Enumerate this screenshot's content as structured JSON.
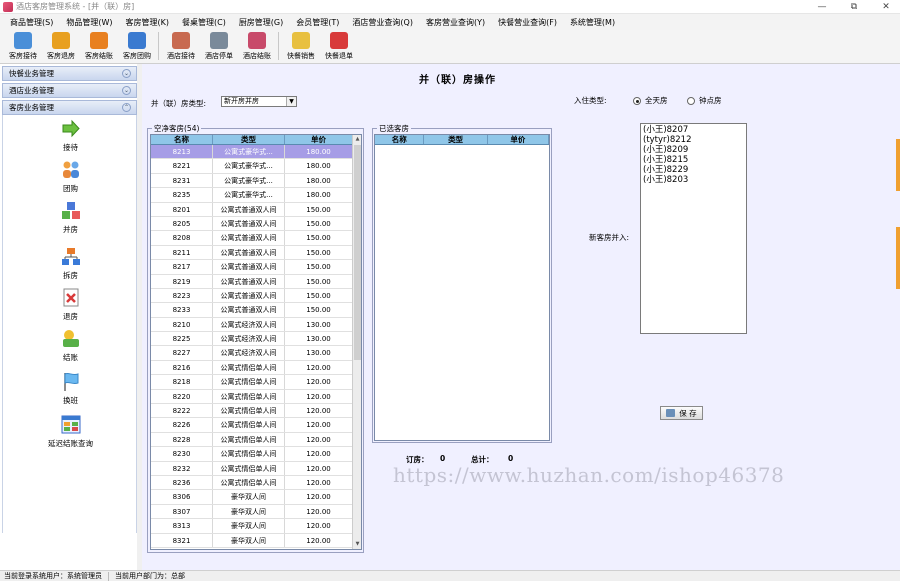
{
  "window": {
    "title": "酒店客房管理系统 - [并（联）房]",
    "controls": [
      "—",
      "⧉",
      "✕"
    ]
  },
  "menu": [
    "商品管理(S)",
    "物品管理(W)",
    "客房管理(K)",
    "餐桌管理(C)",
    "厨房管理(G)",
    "会员管理(T)",
    "酒店营业查询(Q)",
    "客房营业查询(Y)",
    "快餐营业查询(F)",
    "系统管理(M)"
  ],
  "toolbar": [
    {
      "label": "客房接待",
      "icon": "bed-pen-icon",
      "color": "#4a8fd8"
    },
    {
      "label": "客房退房",
      "icon": "checkout-icon",
      "color": "#e8a020"
    },
    {
      "label": "客房结账",
      "icon": "checkout-pay-icon",
      "color": "#e88020"
    },
    {
      "label": "客房团购",
      "icon": "group-buy-icon",
      "color": "#3a7ad0"
    },
    {
      "label": "酒店接待",
      "icon": "reception-card-icon",
      "color": "#c86a50"
    },
    {
      "label": "酒店停单",
      "icon": "tools-icon",
      "color": "#7a8a9a"
    },
    {
      "label": "酒店结账",
      "icon": "people-pay-icon",
      "color": "#c84a6a"
    },
    {
      "label": "快餐销售",
      "icon": "star-sale-icon",
      "color": "#e8c040"
    },
    {
      "label": "快餐退单",
      "icon": "refund-gear-icon",
      "color": "#d83a3a"
    }
  ],
  "sidebar": {
    "sections": [
      "快餐业务管理",
      "酒店业务管理",
      "客房业务管理"
    ],
    "items": [
      {
        "label": "接待",
        "icon": "arrow-right-icon",
        "color": "#4aa82a"
      },
      {
        "label": "团购",
        "icon": "group-people-icon",
        "color": "#e88a2a"
      },
      {
        "label": "并房",
        "icon": "merge-rooms-icon",
        "color": "#3a6ac8"
      },
      {
        "label": "拆房",
        "icon": "split-rooms-icon",
        "color": "#2a7ad8"
      },
      {
        "label": "退房",
        "icon": "checkout-x-icon",
        "color": "#d83a3a"
      },
      {
        "label": "结账",
        "icon": "settle-icon",
        "color": "#e8b020"
      },
      {
        "label": "换班",
        "icon": "flag-icon",
        "color": "#4aa0e0"
      },
      {
        "label": "延迟结账查询",
        "icon": "query-grid-icon",
        "color": "#3a7ad0"
      }
    ]
  },
  "page": {
    "title": "并（联）房操作",
    "type_label": "并（联）房类型:",
    "type_value": "新开房并房",
    "checkin_label": "入住类型:",
    "radio_full_day": "全天房",
    "radio_hourly": "钟点房",
    "empty_group": "空净客房(54)",
    "selected_group": "已选客房",
    "columns": {
      "name": "名称",
      "type": "类型",
      "price": "单价"
    },
    "booking_label": "订房：",
    "booking_value": "0",
    "total_label": "总计：",
    "total_value": "0",
    "merge_label": "新客房并入:",
    "save_button": "保 存",
    "watermark": "https://www.huzhan.com/ishop46378"
  },
  "rooms": [
    {
      "name": "8213",
      "type": "公寓式豪华式...",
      "price": "180.00"
    },
    {
      "name": "8221",
      "type": "公寓式豪华式...",
      "price": "180.00"
    },
    {
      "name": "8231",
      "type": "公寓式豪华式...",
      "price": "180.00"
    },
    {
      "name": "8235",
      "type": "公寓式豪华式...",
      "price": "180.00"
    },
    {
      "name": "8201",
      "type": "公寓式普通双人间",
      "price": "150.00"
    },
    {
      "name": "8205",
      "type": "公寓式普通双人间",
      "price": "150.00"
    },
    {
      "name": "8208",
      "type": "公寓式普通双人间",
      "price": "150.00"
    },
    {
      "name": "8211",
      "type": "公寓式普通双人间",
      "price": "150.00"
    },
    {
      "name": "8217",
      "type": "公寓式普通双人间",
      "price": "150.00"
    },
    {
      "name": "8219",
      "type": "公寓式普通双人间",
      "price": "150.00"
    },
    {
      "name": "8223",
      "type": "公寓式普通双人间",
      "price": "150.00"
    },
    {
      "name": "8233",
      "type": "公寓式普通双人间",
      "price": "150.00"
    },
    {
      "name": "8210",
      "type": "公寓式经济双人间",
      "price": "130.00"
    },
    {
      "name": "8225",
      "type": "公寓式经济双人间",
      "price": "130.00"
    },
    {
      "name": "8227",
      "type": "公寓式经济双人间",
      "price": "130.00"
    },
    {
      "name": "8216",
      "type": "公寓式情侣单人间",
      "price": "120.00"
    },
    {
      "name": "8218",
      "type": "公寓式情侣单人间",
      "price": "120.00"
    },
    {
      "name": "8220",
      "type": "公寓式情侣单人间",
      "price": "120.00"
    },
    {
      "name": "8222",
      "type": "公寓式情侣单人间",
      "price": "120.00"
    },
    {
      "name": "8226",
      "type": "公寓式情侣单人间",
      "price": "120.00"
    },
    {
      "name": "8228",
      "type": "公寓式情侣单人间",
      "price": "120.00"
    },
    {
      "name": "8230",
      "type": "公寓式情侣单人间",
      "price": "120.00"
    },
    {
      "name": "8232",
      "type": "公寓式情侣单人间",
      "price": "120.00"
    },
    {
      "name": "8236",
      "type": "公寓式情侣单人间",
      "price": "120.00"
    },
    {
      "name": "8306",
      "type": "豪华双人间",
      "price": "120.00"
    },
    {
      "name": "8307",
      "type": "豪华双人间",
      "price": "120.00"
    },
    {
      "name": "8313",
      "type": "豪华双人间",
      "price": "120.00"
    },
    {
      "name": "8321",
      "type": "豪华双人间",
      "price": "120.00"
    }
  ],
  "merge_list": [
    "(小王)8207",
    "(tytyr)8212",
    "(小王)8209",
    "(小王)8215",
    "(小王)8229",
    "(小王)8203"
  ],
  "status": {
    "user": "当前登录系统用户：系统管理员",
    "dept": "当前用户部门为：总部"
  }
}
